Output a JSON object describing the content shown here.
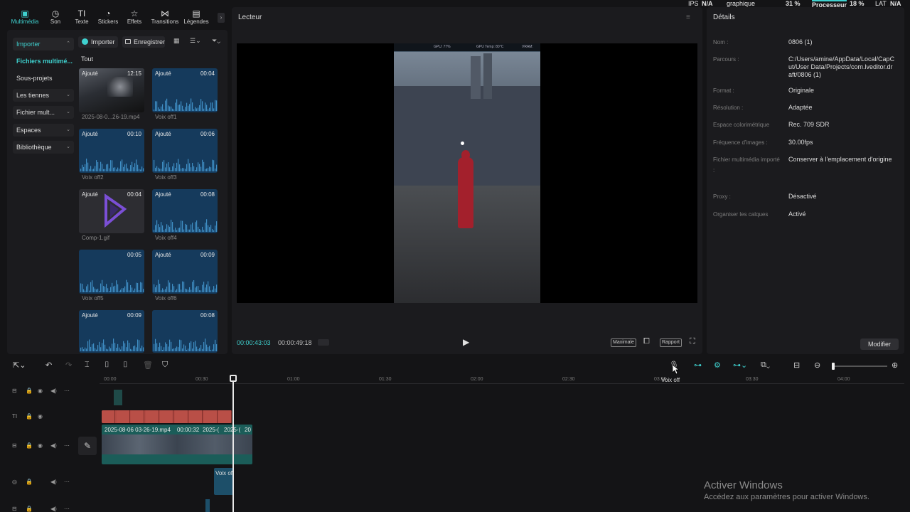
{
  "top_status": {
    "ips": "IPS",
    "ips_val": "N/A",
    "gpu": "graphique",
    "gpu_val": "31 %",
    "cpu": "Processeur",
    "cpu_val": "18 %",
    "lat": "LAT",
    "lat_val": "N/A"
  },
  "toolbar": [
    {
      "label": "Multimédia",
      "icon": "media-icon"
    },
    {
      "label": "Son",
      "icon": "audio-icon"
    },
    {
      "label": "Texte",
      "icon": "text-icon"
    },
    {
      "label": "Stickers",
      "icon": "sticker-icon"
    },
    {
      "label": "Effets",
      "icon": "effects-icon"
    },
    {
      "label": "Transitions",
      "icon": "transition-icon"
    },
    {
      "label": "Légendes",
      "icon": "captions-icon"
    }
  ],
  "sidebar": {
    "items": [
      {
        "label": "Importer"
      },
      {
        "label": "Fichiers multimé..."
      },
      {
        "label": "Sous-projets"
      },
      {
        "label": "Les tiennes"
      },
      {
        "label": "Fichier mult..."
      },
      {
        "label": "Espaces"
      },
      {
        "label": "Bibliothèque"
      }
    ]
  },
  "media": {
    "import_btn": "Importer",
    "record_btn": "Enregistrer",
    "all_label": "Tout",
    "items": [
      {
        "tag": "Ajouté",
        "dur": "12:15",
        "name": "2025-08-0...26-19.mp4"
      },
      {
        "tag": "Ajouté",
        "dur": "00:04",
        "name": "Voix off1"
      },
      {
        "tag": "Ajouté",
        "dur": "00:10",
        "name": "Voix off2"
      },
      {
        "tag": "Ajouté",
        "dur": "00:06",
        "name": "Voix off3"
      },
      {
        "tag": "Ajouté",
        "dur": "00:04",
        "name": "Comp-1.gif"
      },
      {
        "tag": "Ajouté",
        "dur": "00:08",
        "name": "Voix off4"
      },
      {
        "tag": "",
        "dur": "00:05",
        "name": "Voix off5"
      },
      {
        "tag": "Ajouté",
        "dur": "00:09",
        "name": "Voix off6"
      },
      {
        "tag": "Ajouté",
        "dur": "00:09",
        "name": ""
      },
      {
        "tag": "",
        "dur": "00:08",
        "name": ""
      }
    ]
  },
  "player": {
    "title": "Lecteur",
    "tc_current": "00:00:43:03",
    "tc_total": "00:00:49:18",
    "btn_max": "Maximale",
    "btn_ratio": "Rapport",
    "hud": "GPU: 77%",
    "hud2": "GPU Temp: 80°C",
    "hud3": "VRAM:"
  },
  "details": {
    "title": "Détails",
    "rows": [
      {
        "k": "Nom :",
        "v": "0806 (1)"
      },
      {
        "k": "Parcours :",
        "v": "C:/Users/amine/AppData/Local/CapCut/User Data/Projects/com.lveditor.draft/0806 (1)"
      },
      {
        "k": "Format :",
        "v": "Originale"
      },
      {
        "k": "Résolution :",
        "v": "Adaptée"
      },
      {
        "k": "Espace colorimétrique",
        "v": "Rec. 709 SDR"
      },
      {
        "k": "Fréquence d'images :",
        "v": "30.00fps"
      },
      {
        "k": "Fichier multimédia importé :",
        "v": "Conserver à l'emplacement d'origine"
      },
      {
        "k": "Proxy :",
        "v": "Désactivé"
      },
      {
        "k": "Organiser les calques",
        "v": "Activé"
      }
    ],
    "modify": "Modifier"
  },
  "timeline": {
    "ticks": [
      "00:00",
      "00:30",
      "01:00",
      "01:30",
      "02:00",
      "02:30",
      "03:00",
      "03:30",
      "04:00"
    ],
    "video_labels": [
      "2025-08-06 03-26-19.mp4",
      "00:00:32",
      "2025-(",
      "2025-(",
      "20"
    ],
    "audio_label": "Voix of",
    "tooltip": "Voix off"
  },
  "watermark": {
    "line1": "Activer Windows",
    "line2": "Accédez aux paramètres pour activer Windows."
  },
  "colors": {
    "accent": "#3fd1cf",
    "text_clip": "#b34a43",
    "video_clip": "#1b5d59",
    "audio_clip": "#1d4f69"
  }
}
